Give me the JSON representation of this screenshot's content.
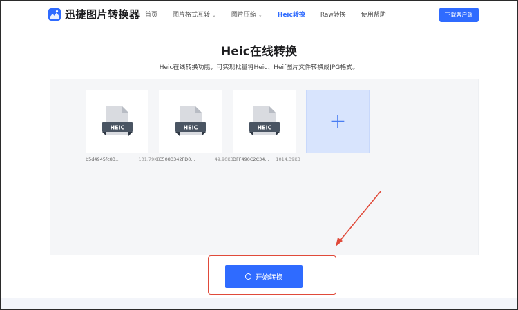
{
  "header": {
    "logo_text": "迅捷图片转换器",
    "nav": [
      {
        "label": "首页",
        "has_dropdown": false,
        "active": false
      },
      {
        "label": "图片格式互转",
        "has_dropdown": true,
        "active": false
      },
      {
        "label": "图片压缩",
        "has_dropdown": true,
        "active": false
      },
      {
        "label": "Heic转换",
        "has_dropdown": false,
        "active": true
      },
      {
        "label": "Raw转换",
        "has_dropdown": false,
        "active": false
      },
      {
        "label": "使用帮助",
        "has_dropdown": false,
        "active": false
      }
    ],
    "download_label": "下载客户端"
  },
  "main": {
    "title": "Heic在线转换",
    "subtitle": "Heic在线转换功能，可实现批量将Heic、Heif图片文件转换成JPG格式。",
    "files": [
      {
        "name": "b5d4945fc83...",
        "size": "101.79KB",
        "badge": "HEIC"
      },
      {
        "name": "C5083342FD0...",
        "size": "49.90KB",
        "badge": "HEIC"
      },
      {
        "name": "DFF490C2C34...",
        "size": "1014.39KB",
        "badge": "HEIC"
      }
    ],
    "add_symbol": "+",
    "start_label": "开始转换"
  },
  "colors": {
    "accent": "#2f6bff",
    "annotation": "#e04a3a",
    "upload_bg": "#f5f6f8",
    "add_tile_bg": "#d8e4fd"
  },
  "icons": {
    "logo": "image-logo-icon",
    "file": "heic-file-icon",
    "add": "plus-icon",
    "start": "loading-circle-icon",
    "dropdown": "chevron-down-icon"
  }
}
